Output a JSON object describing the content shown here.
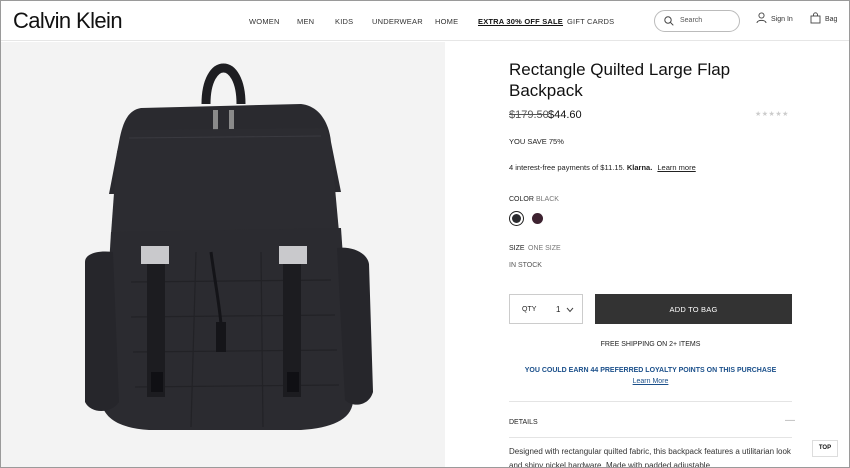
{
  "brand": "Calvin Klein",
  "nav": [
    "WOMEN",
    "MEN",
    "KIDS",
    "UNDERWEAR",
    "HOME",
    "EXTRA 30% OFF SALE",
    "GIFT CARDS"
  ],
  "search": {
    "placeholder": "Search"
  },
  "account": {
    "sign_in": "Sign In",
    "bag": "Bag"
  },
  "product": {
    "title": "Rectangle Quilted Large Flap Backpack",
    "price_original": "$179.50",
    "price_sale": "$44.60",
    "stars": "★★★★★",
    "savings": "YOU SAVE 75%",
    "klarna_text": "4 interest-free payments of $11.15.",
    "klarna_brand": "Klarna.",
    "klarna_link": "Learn more",
    "color_label": "COLOR",
    "color_value": "BLACK",
    "swatches": [
      "#2a2a2e",
      "#3d2230"
    ],
    "size_label": "SIZE",
    "size_value": "ONE SIZE",
    "stock": "IN STOCK",
    "qty_label": "QTY",
    "qty_value": "1",
    "add_to_bag": "ADD TO BAG",
    "free_shipping": "FREE SHIPPING ON 2+ ITEMS",
    "loyalty": "YOU COULD EARN 44 PREFERRED LOYALTY POINTS ON THIS PURCHASE",
    "loyalty_link": "Learn More",
    "details_label": "DETAILS",
    "details_toggle": "—",
    "description": "Designed with rectangular quilted fabric, this backpack features a utilitarian look and shiny nickel hardware. Made with padded adjustable"
  },
  "back_to_top": "TOP"
}
